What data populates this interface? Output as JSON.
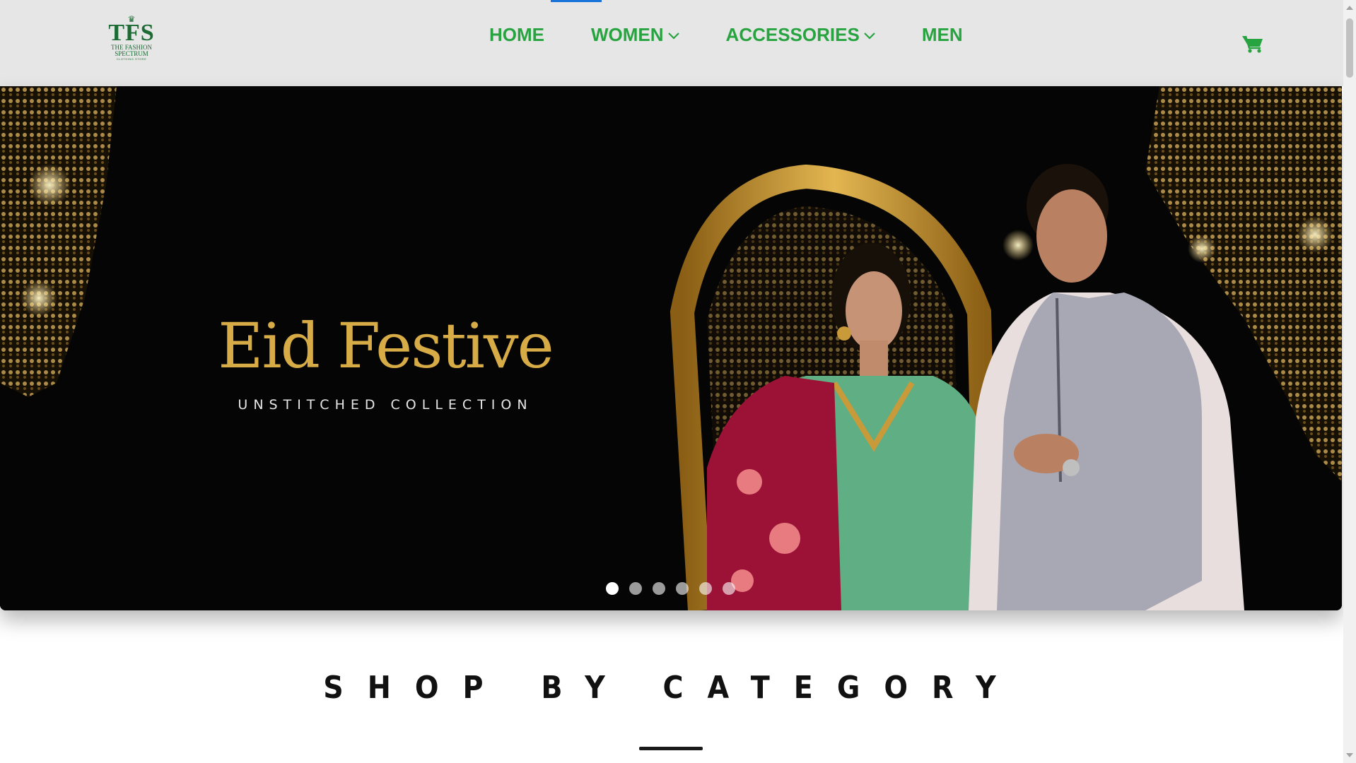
{
  "logo": {
    "mark": "TFS",
    "line1": "THE FASHION",
    "line2": "SPECTRUM",
    "line3": "CLOTHING STORE"
  },
  "nav": {
    "home": "HOME",
    "women": "WOMEN",
    "accessories": "ACCESSORIES",
    "men": "MEN"
  },
  "hero": {
    "title": "Eid Festive",
    "subtitle": "UNSTITCHED COLLECTION",
    "slide_count": 6,
    "active_slide": 1
  },
  "section": {
    "title": "SHOP BY CATEGORY"
  },
  "colors": {
    "brand_green": "#27a33f",
    "logo_green": "#1d6b34",
    "hero_gold": "#d7ab46",
    "nav_bg": "#e6e6e6",
    "accent_blue": "#1a73d9"
  },
  "icons": {
    "cart": "shopping-cart-icon",
    "dropdown": "chevron-down-icon"
  }
}
